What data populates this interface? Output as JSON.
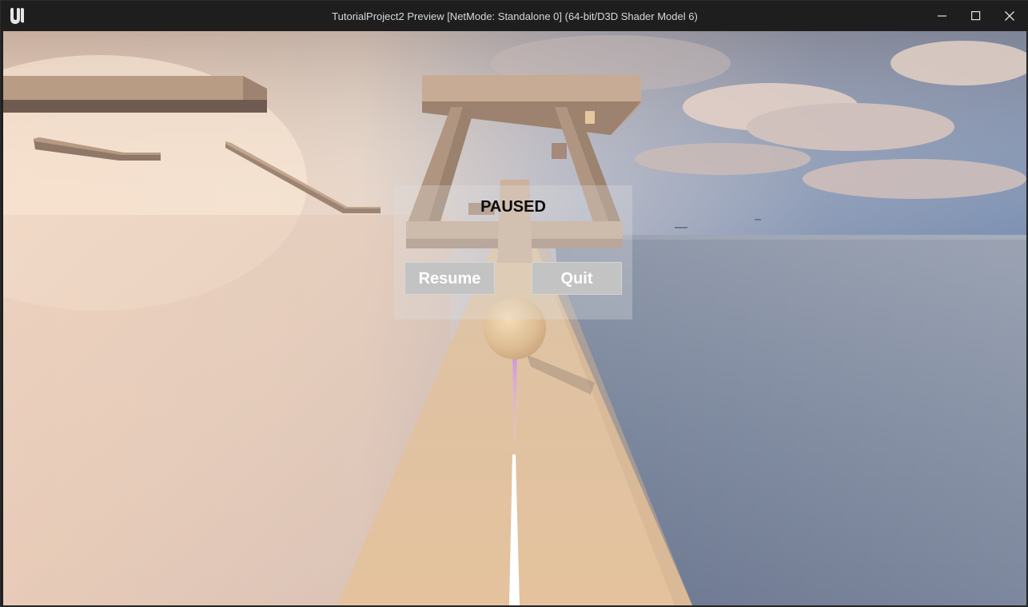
{
  "window": {
    "title": "TutorialProject2 Preview [NetMode: Standalone 0]  (64-bit/D3D Shader Model 6)",
    "logo_icon": "unreal-engine-logo-icon",
    "controls": {
      "minimize_icon": "minimize-icon",
      "maximize_icon": "maximize-icon",
      "close_icon": "close-icon"
    }
  },
  "pause_menu": {
    "title": "PAUSED",
    "resume_label": "Resume",
    "quit_label": "Quit"
  },
  "colors": {
    "titlebar": "#1e1e1e",
    "track": "#e0c39f",
    "platform": "#b89c82",
    "sky_left": "#f2dcc7",
    "sky_right": "#7f91ad",
    "button_bg": "#c3c3c3",
    "trail": "#d8a6e8"
  }
}
